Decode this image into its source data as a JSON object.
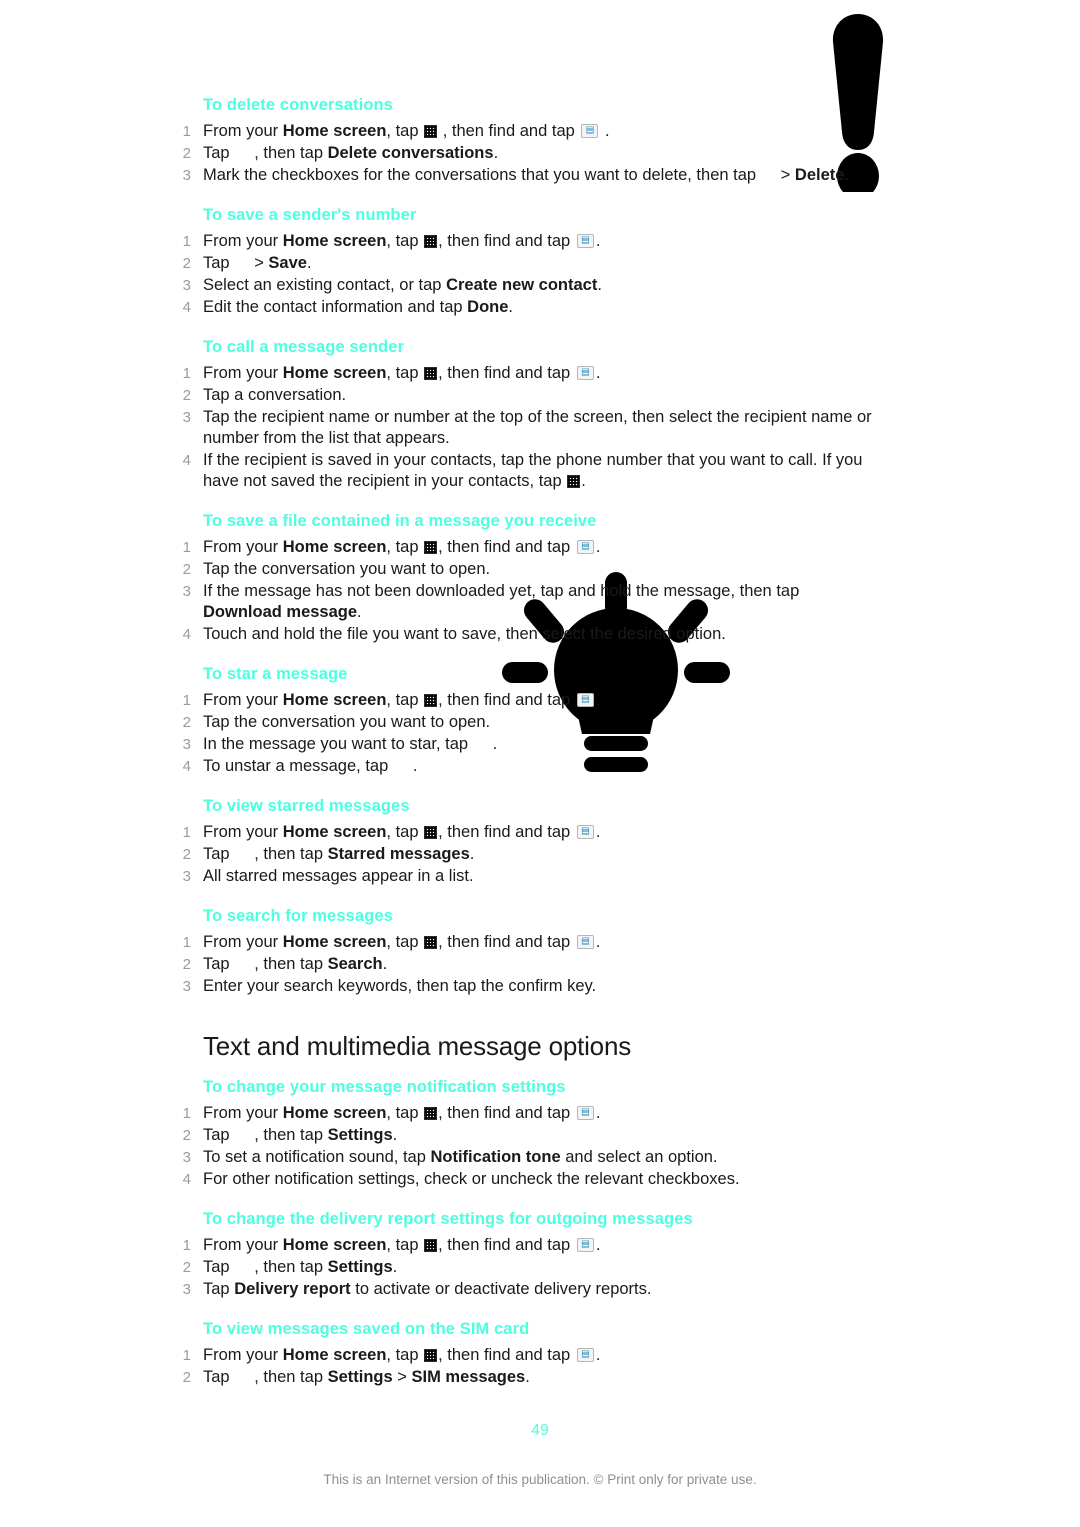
{
  "document": {
    "page_number": "49",
    "footer_note": "This is an Internet version of this publication. © Print only for private use.",
    "heading_color": "#4dffe0",
    "body_color": "#1a1a1a",
    "number_color": "#9b9b9b"
  },
  "graphics": [
    {
      "name": "exclamation-mark-graphic",
      "kind": "note-marker"
    },
    {
      "name": "lightbulb-graphic",
      "kind": "tip-marker"
    }
  ],
  "icons": {
    "app_drawer": "app-drawer-grid-icon",
    "messaging": "messaging-app-icon",
    "dialpad": "dialpad-grid-icon",
    "missing": "missing-glyph"
  },
  "sections": [
    {
      "id": "procedures-top",
      "title": null,
      "procedures": [
        {
          "heading": "To delete conversations",
          "steps": [
            {
              "parts": [
                {
                  "t": "From your "
                },
                {
                  "t": "Home screen",
                  "b": true
                },
                {
                  "t": ", tap "
                },
                {
                  "icon": "grid"
                },
                {
                  "t": " , then find and tap "
                },
                {
                  "icon": "msg"
                },
                {
                  "t": " ."
                }
              ]
            },
            {
              "parts": [
                {
                  "t": "Tap "
                },
                {
                  "icon": "blank"
                },
                {
                  "t": ", then tap "
                },
                {
                  "t": "Delete conversations",
                  "b": true
                },
                {
                  "t": "."
                }
              ]
            },
            {
              "parts": [
                {
                  "t": "Mark the checkboxes for the conversations that you want to delete, then tap "
                },
                {
                  "icon": "blank"
                },
                {
                  "t": "> "
                },
                {
                  "t": "Delete",
                  "b": true
                },
                {
                  "t": "."
                }
              ]
            }
          ]
        },
        {
          "heading": "To save a sender's number",
          "steps": [
            {
              "parts": [
                {
                  "t": "From your "
                },
                {
                  "t": "Home screen",
                  "b": true
                },
                {
                  "t": ", tap "
                },
                {
                  "icon": "grid"
                },
                {
                  "t": ", then find and tap "
                },
                {
                  "icon": "msg"
                },
                {
                  "t": "."
                }
              ]
            },
            {
              "parts": [
                {
                  "t": "Tap "
                },
                {
                  "icon": "blank"
                },
                {
                  "t": "> "
                },
                {
                  "t": "Save",
                  "b": true
                },
                {
                  "t": "."
                }
              ]
            },
            {
              "parts": [
                {
                  "t": "Select an existing contact, or tap "
                },
                {
                  "t": "Create new contact",
                  "b": true
                },
                {
                  "t": "."
                }
              ]
            },
            {
              "parts": [
                {
                  "t": "Edit the contact information and tap "
                },
                {
                  "t": "Done",
                  "b": true
                },
                {
                  "t": "."
                }
              ]
            }
          ]
        },
        {
          "heading": "To call a message sender",
          "steps": [
            {
              "parts": [
                {
                  "t": "From your "
                },
                {
                  "t": "Home screen",
                  "b": true
                },
                {
                  "t": ", tap "
                },
                {
                  "icon": "grid"
                },
                {
                  "t": ", then find and tap "
                },
                {
                  "icon": "msg"
                },
                {
                  "t": "."
                }
              ]
            },
            {
              "parts": [
                {
                  "t": "Tap a conversation."
                }
              ]
            },
            {
              "parts": [
                {
                  "t": "Tap the recipient name or number at the top of the screen, then select the recipient name or number from the list that appears."
                }
              ]
            },
            {
              "parts": [
                {
                  "t": "If the recipient is saved in your contacts, tap the phone number that you want to call. If you have not saved the recipient in your contacts, tap "
                },
                {
                  "icon": "grid"
                },
                {
                  "t": "."
                }
              ]
            }
          ]
        },
        {
          "heading": "To save a file contained in a message you receive",
          "steps": [
            {
              "parts": [
                {
                  "t": "From your "
                },
                {
                  "t": "Home screen",
                  "b": true
                },
                {
                  "t": ", tap "
                },
                {
                  "icon": "grid"
                },
                {
                  "t": ", then find and tap "
                },
                {
                  "icon": "msg"
                },
                {
                  "t": "."
                }
              ]
            },
            {
              "parts": [
                {
                  "t": "Tap the conversation you want to open."
                }
              ]
            },
            {
              "parts": [
                {
                  "t": "If the message has not been downloaded yet, tap and hold the message, then tap "
                },
                {
                  "t": "Download message",
                  "b": true
                },
                {
                  "t": "."
                }
              ]
            },
            {
              "parts": [
                {
                  "t": "Touch and hold the file you want to save, then select the desired option."
                }
              ]
            }
          ]
        },
        {
          "heading": "To star a message",
          "steps": [
            {
              "parts": [
                {
                  "t": "From your "
                },
                {
                  "t": "Home screen",
                  "b": true
                },
                {
                  "t": ", tap "
                },
                {
                  "icon": "grid"
                },
                {
                  "t": ", then find and tap "
                },
                {
                  "icon": "msg"
                },
                {
                  "t": "."
                }
              ]
            },
            {
              "parts": [
                {
                  "t": "Tap the conversation you want to open."
                }
              ]
            },
            {
              "parts": [
                {
                  "t": "In the message you want to star, tap "
                },
                {
                  "icon": "blank"
                },
                {
                  "t": "."
                }
              ]
            },
            {
              "parts": [
                {
                  "t": "To unstar a message, tap "
                },
                {
                  "icon": "blank"
                },
                {
                  "t": "."
                }
              ]
            }
          ]
        },
        {
          "heading": "To view starred messages",
          "steps": [
            {
              "parts": [
                {
                  "t": "From your "
                },
                {
                  "t": "Home screen",
                  "b": true
                },
                {
                  "t": ", tap "
                },
                {
                  "icon": "grid"
                },
                {
                  "t": ", then find and tap "
                },
                {
                  "icon": "msg"
                },
                {
                  "t": "."
                }
              ]
            },
            {
              "parts": [
                {
                  "t": "Tap "
                },
                {
                  "icon": "blank"
                },
                {
                  "t": ", then tap "
                },
                {
                  "t": "Starred messages",
                  "b": true
                },
                {
                  "t": "."
                }
              ]
            },
            {
              "parts": [
                {
                  "t": "All starred messages appear in a list."
                }
              ]
            }
          ]
        },
        {
          "heading": "To search for messages",
          "steps": [
            {
              "parts": [
                {
                  "t": "From your "
                },
                {
                  "t": "Home screen",
                  "b": true
                },
                {
                  "t": ", tap "
                },
                {
                  "icon": "grid"
                },
                {
                  "t": ", then find and tap "
                },
                {
                  "icon": "msg"
                },
                {
                  "t": "."
                }
              ]
            },
            {
              "parts": [
                {
                  "t": "Tap "
                },
                {
                  "icon": "blank"
                },
                {
                  "t": ", then tap "
                },
                {
                  "t": "Search",
                  "b": true
                },
                {
                  "t": "."
                }
              ]
            },
            {
              "parts": [
                {
                  "t": "Enter your search keywords, then tap the confirm key."
                }
              ]
            }
          ]
        }
      ]
    },
    {
      "id": "text-and-multimedia-message-options",
      "title": "Text and multimedia message options",
      "procedures": [
        {
          "heading": "To change your message notification settings",
          "steps": [
            {
              "parts": [
                {
                  "t": "From your "
                },
                {
                  "t": "Home screen",
                  "b": true
                },
                {
                  "t": ", tap "
                },
                {
                  "icon": "grid"
                },
                {
                  "t": ", then find and tap "
                },
                {
                  "icon": "msg"
                },
                {
                  "t": "."
                }
              ]
            },
            {
              "parts": [
                {
                  "t": "Tap "
                },
                {
                  "icon": "blank"
                },
                {
                  "t": ", then tap "
                },
                {
                  "t": "Settings",
                  "b": true
                },
                {
                  "t": "."
                }
              ]
            },
            {
              "parts": [
                {
                  "t": "To set a notification sound, tap "
                },
                {
                  "t": "Notification tone",
                  "b": true
                },
                {
                  "t": " and select an option."
                }
              ]
            },
            {
              "parts": [
                {
                  "t": "For other notification settings, check or uncheck the relevant checkboxes."
                }
              ]
            }
          ]
        },
        {
          "heading": "To change the delivery report settings for outgoing messages",
          "steps": [
            {
              "parts": [
                {
                  "t": "From your "
                },
                {
                  "t": "Home screen",
                  "b": true
                },
                {
                  "t": ", tap "
                },
                {
                  "icon": "grid"
                },
                {
                  "t": ", then find and tap "
                },
                {
                  "icon": "msg"
                },
                {
                  "t": "."
                }
              ]
            },
            {
              "parts": [
                {
                  "t": "Tap "
                },
                {
                  "icon": "blank"
                },
                {
                  "t": ", then tap "
                },
                {
                  "t": "Settings",
                  "b": true
                },
                {
                  "t": "."
                }
              ]
            },
            {
              "parts": [
                {
                  "t": "Tap "
                },
                {
                  "t": "Delivery report",
                  "b": true
                },
                {
                  "t": " to activate or deactivate delivery reports."
                }
              ]
            }
          ]
        },
        {
          "heading": "To view messages saved on the SIM card",
          "steps": [
            {
              "parts": [
                {
                  "t": "From your "
                },
                {
                  "t": "Home screen",
                  "b": true
                },
                {
                  "t": ", tap "
                },
                {
                  "icon": "grid"
                },
                {
                  "t": ", then find and tap "
                },
                {
                  "icon": "msg"
                },
                {
                  "t": "."
                }
              ]
            },
            {
              "parts": [
                {
                  "t": "Tap "
                },
                {
                  "icon": "blank"
                },
                {
                  "t": ", then tap "
                },
                {
                  "t": "Settings",
                  "b": true
                },
                {
                  "t": " > "
                },
                {
                  "t": "SIM messages",
                  "b": true
                },
                {
                  "t": "."
                }
              ]
            }
          ]
        }
      ]
    }
  ]
}
